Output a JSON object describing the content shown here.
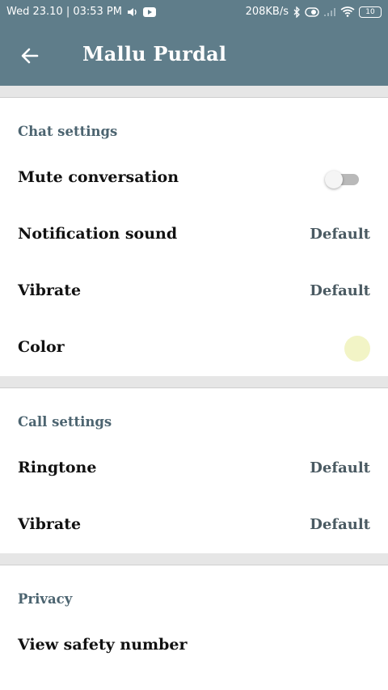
{
  "status_bar": {
    "datetime": "Wed 23.10 | 03:53 PM",
    "network_speed": "208KB/s",
    "battery": "10"
  },
  "app_bar": {
    "title": "Mallu Purdal"
  },
  "chat_settings": {
    "header": "Chat settings",
    "mute": {
      "label": "Mute conversation",
      "enabled": false
    },
    "notification_sound": {
      "label": "Notification sound",
      "value": "Default"
    },
    "vibrate": {
      "label": "Vibrate",
      "value": "Default"
    },
    "color": {
      "label": "Color",
      "swatch": "#f2f4c6"
    }
  },
  "call_settings": {
    "header": "Call settings",
    "ringtone": {
      "label": "Ringtone",
      "value": "Default"
    },
    "vibrate": {
      "label": "Vibrate",
      "value": "Default"
    }
  },
  "privacy": {
    "header": "Privacy",
    "safety_number": {
      "label": "View safety number"
    }
  },
  "colors": {
    "bar": "#5f7d8a",
    "section_header": "#4c6470"
  }
}
